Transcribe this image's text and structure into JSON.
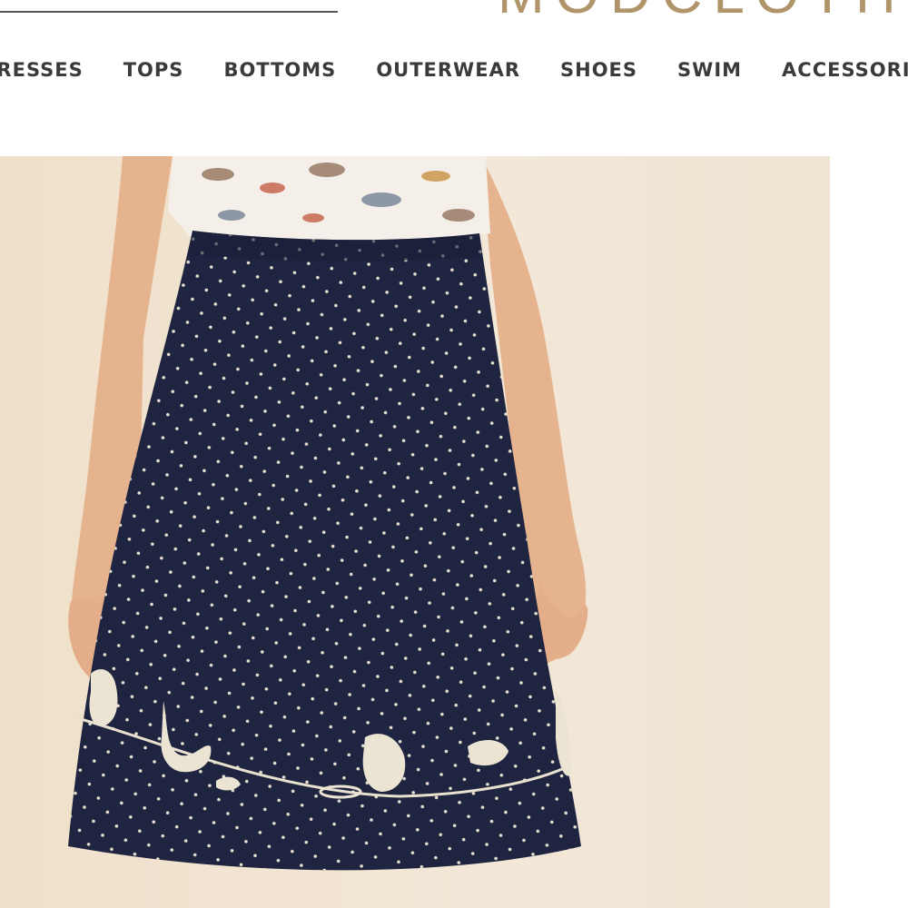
{
  "brand": {
    "logo_text": "MODCLOTH"
  },
  "nav": {
    "items": [
      {
        "label": "DRESSES"
      },
      {
        "label": "TOPS"
      },
      {
        "label": "BOTTOMS"
      },
      {
        "label": "OUTERWEAR"
      },
      {
        "label": "SHOES"
      },
      {
        "label": "SWIM"
      },
      {
        "label": "ACCESSORIES"
      }
    ]
  },
  "colors": {
    "logo": "#b0956a",
    "nav_text": "#3a3a3a",
    "skirt": "#1f2540",
    "dot": "#e8e2d2",
    "background": "#efe2cf",
    "skin": "#e9b997"
  }
}
